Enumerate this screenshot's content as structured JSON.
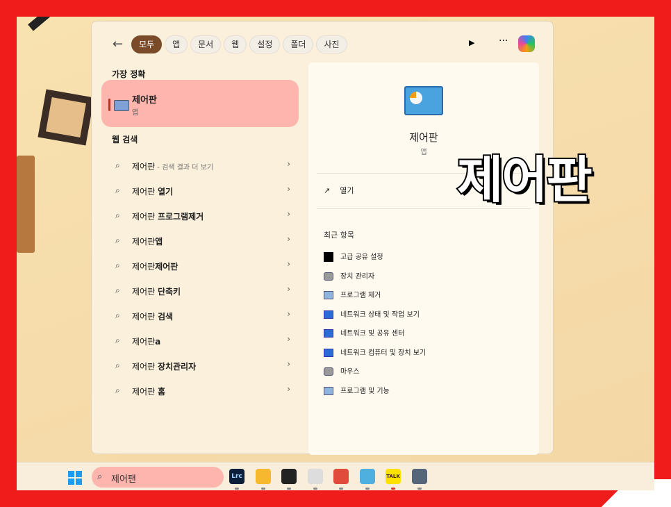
{
  "filters": {
    "back": "←",
    "items": [
      "모두",
      "앱",
      "문서",
      "웹",
      "설정",
      "폴더",
      "사진"
    ],
    "active": 0
  },
  "best_match": {
    "heading": "가장 정확",
    "title": "제어판",
    "subtitle": "앱"
  },
  "web_search": {
    "heading": "웹 검색",
    "items": [
      {
        "prefix": "제어판",
        "bold": "",
        "note": " - 검색 결과 더 보기"
      },
      {
        "prefix": "제어판 ",
        "bold": "열기",
        "note": ""
      },
      {
        "prefix": "제어판 ",
        "bold": "프로그램제거",
        "note": ""
      },
      {
        "prefix": "제어판",
        "bold": "앱",
        "note": ""
      },
      {
        "prefix": "제어판",
        "bold": "제어판",
        "note": ""
      },
      {
        "prefix": "제어판 ",
        "bold": "단축키",
        "note": ""
      },
      {
        "prefix": "제어판 ",
        "bold": "검색",
        "note": ""
      },
      {
        "prefix": "제어판",
        "bold": "a",
        "note": ""
      },
      {
        "prefix": "제어판 ",
        "bold": "장치관리자",
        "note": ""
      },
      {
        "prefix": "제어판 ",
        "bold": "홈",
        "note": ""
      }
    ]
  },
  "detail": {
    "title": "제어판",
    "subtitle": "앱",
    "open": "열기",
    "recent_heading": "최근 항목",
    "recent": [
      {
        "label": "고급 공유 설정",
        "icon": "black"
      },
      {
        "label": "장치 관리자",
        "icon": "dev"
      },
      {
        "label": "프로그램 제거",
        "icon": "prog"
      },
      {
        "label": "네트워크 상태 및 작업 보기",
        "icon": "net"
      },
      {
        "label": "네트워크 및 공유 센터",
        "icon": "net"
      },
      {
        "label": "네트워크 컴퓨터 및 장치 보기",
        "icon": "net"
      },
      {
        "label": "마우스",
        "icon": "dev"
      },
      {
        "label": "프로그램 및 기능",
        "icon": "prog"
      }
    ]
  },
  "overlay_text": "제어판",
  "taskbar": {
    "search_value": "제어팬",
    "apps": [
      {
        "name": "lightroom",
        "label": "Lrc",
        "color": "#0b1f3a"
      },
      {
        "name": "file-explorer",
        "color": "#f5b82e"
      },
      {
        "name": "obs",
        "color": "#222"
      },
      {
        "name": "app-4",
        "color": "#ddd"
      },
      {
        "name": "chrome",
        "color": "#e04b3c"
      },
      {
        "name": "notepad",
        "color": "#4fb0e0"
      },
      {
        "name": "kakaotalk",
        "label": "TALK",
        "color": "#ffe100"
      },
      {
        "name": "settings",
        "color": "#56667a"
      }
    ]
  }
}
